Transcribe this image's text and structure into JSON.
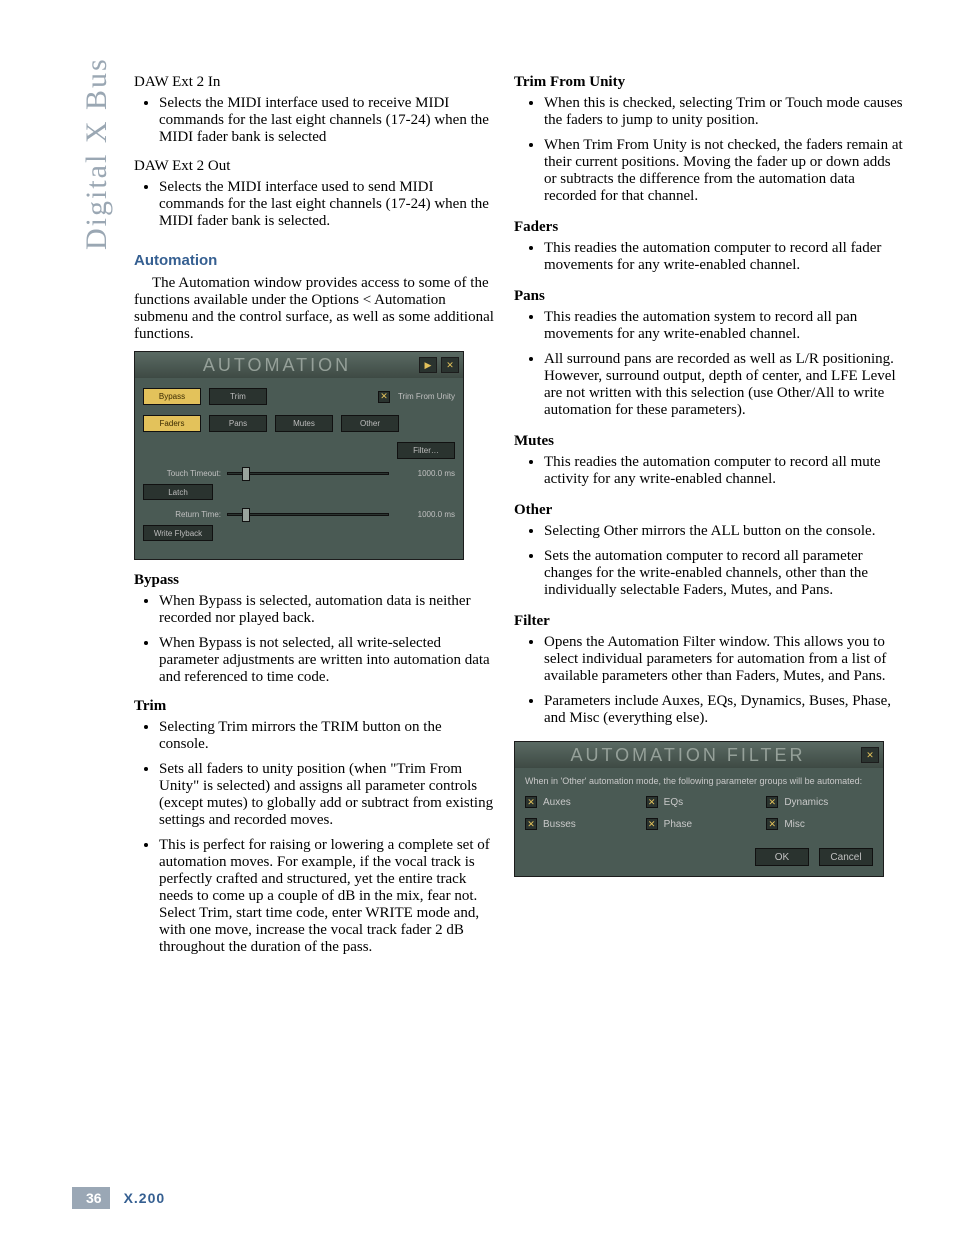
{
  "spine": "Digital X Bus",
  "footer": {
    "page": "36",
    "model": "X.200"
  },
  "col1": {
    "daw2in_title": "DAW Ext 2 In",
    "daw2in_bullet": "Selects the MIDI interface used to receive MIDI commands for the last eight channels (17-24) when the MIDI fader bank is selected",
    "daw2out_title": "DAW Ext 2 Out",
    "daw2out_bullet": "Selects the MIDI interface used to send MIDI commands for the last eight channels (17-24) when the MIDI fader bank is selected.",
    "automation_heading": "Automation",
    "automation_intro": "The Automation window provides access to some of the functions available under the Options < Automation submenu and the control surface, as well as some additional functions.",
    "panel": {
      "title": "AUTOMATION",
      "play_glyph": "▶",
      "close_glyph": "✕",
      "bypass": "Bypass",
      "trim": "Trim",
      "trim_from_unity": "Trim From Unity",
      "faders": "Faders",
      "pans": "Pans",
      "mutes": "Mutes",
      "other": "Other",
      "filter": "Filter…",
      "touch_timeout_label": "Touch Timeout:",
      "touch_timeout_val": "1000.0 ms",
      "latch": "Latch",
      "return_time_label": "Return Time:",
      "return_time_val": "1000.0 ms",
      "write_flyback": "Write Flyback"
    },
    "bypass_h": "Bypass",
    "bypass_b1": "When Bypass is selected, automation data is neither recorded nor played back.",
    "bypass_b2": "When Bypass is not selected, all write-selected parameter adjustments are written into automation data and referenced to time code.",
    "trim_h": "Trim",
    "trim_b1": "Selecting Trim mirrors the TRIM button on the console.",
    "trim_b2": "Sets all faders to unity position (when \"Trim From Unity\" is selected) and assigns all parameter controls (except mutes) to globally add or subtract from existing settings and recorded moves.",
    "trim_b3": "This is perfect for raising or lowering a complete set of automation moves. For example, if the vocal track is perfectly crafted and structured, yet the entire track needs to come up a couple of dB in the mix, fear not. Select Trim, start time code, enter WRITE mode and, with one move, increase the vocal track fader 2 dB throughout the duration of the pass."
  },
  "col2": {
    "tfu_h": "Trim From Unity",
    "tfu_b1": "When this is checked, selecting Trim or Touch mode causes the faders to jump to unity position.",
    "tfu_b2": "When Trim From Unity is not checked, the faders remain at their current positions. Moving the fader up or down adds or subtracts the difference from the automation data recorded for that channel.",
    "faders_h": "Faders",
    "faders_b1": "This readies the automation computer to record all fader movements for any write-enabled channel.",
    "pans_h": "Pans",
    "pans_b1": "This readies the automation system to record all pan movements for any write-enabled channel.",
    "pans_b2": "All surround pans are recorded as well as L/R positioning. However, surround output, depth of center, and LFE Level are not written with this selection (use Other/All to write automation for these parameters).",
    "mutes_h": "Mutes",
    "mutes_b1": "This readies the automation computer to record all mute activity for any write-enabled channel.",
    "other_h": "Other",
    "other_b1": "Selecting Other mirrors the ALL button on the console.",
    "other_b2": "Sets the automation computer to record all parameter changes for the write-enabled channels, other than the individually selectable Faders, Mutes, and Pans.",
    "filter_h": "Filter",
    "filter_b1": "Opens the Automation Filter window. This allows you to select individual parameters for automation from a list of available parameters other than Faders, Mutes, and Pans.",
    "filter_b2": "Parameters include Auxes, EQs, Dynamics, Buses, Phase, and Misc (everything else).",
    "afPanel": {
      "title": "AUTOMATION FILTER",
      "close_glyph": "✕",
      "desc": "When in 'Other' automation mode, the following parameter groups will be automated:",
      "auxes": "Auxes",
      "eqs": "EQs",
      "dynamics": "Dynamics",
      "busses": "Busses",
      "phase": "Phase",
      "misc": "Misc",
      "ok": "OK",
      "cancel": "Cancel",
      "chk": "✕"
    }
  }
}
